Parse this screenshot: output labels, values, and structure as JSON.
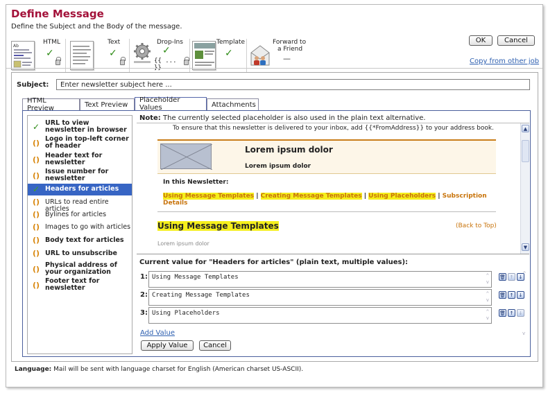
{
  "window": {
    "title": "Define Message",
    "subtitle": "Define the Subject and the Body of the message."
  },
  "toolbar": {
    "html_label": "HTML",
    "text_label": "Text",
    "dropins_label": "Drop-Ins",
    "dropins_code": "{{ ... }}",
    "template_label": "Template",
    "forward_label_1": "Forward to",
    "forward_label_2": "a Friend",
    "forward_status": "—",
    "check": "✓",
    "ok_label": "OK",
    "cancel_label": "Cancel",
    "copy_link": "Copy from other job"
  },
  "subject": {
    "label": "Subject:",
    "value": "Enter newsletter subject here ..."
  },
  "tabs": [
    {
      "label": "HTML Preview"
    },
    {
      "label": "Text Preview"
    },
    {
      "label": "Placeholder Values"
    },
    {
      "label": "Attachments"
    }
  ],
  "placeholders": [
    {
      "label": "URL to view newsletter in browser",
      "status": "done"
    },
    {
      "label": "Logo in top-left corner of header",
      "status": "pending"
    },
    {
      "label": "Header text for newsletter",
      "status": "pending"
    },
    {
      "label": "Issue number for newsletter",
      "status": "pending"
    },
    {
      "label": "Headers for articles",
      "status": "done"
    },
    {
      "label": "URLs to read entire articles",
      "status": "pending"
    },
    {
      "label": "Bylines for articles",
      "status": "pending"
    },
    {
      "label": "Images to go with articles",
      "status": "pending"
    },
    {
      "label": "Body text for articles",
      "status": "pending"
    },
    {
      "label": "URL to unsubscribe",
      "status": "pending"
    },
    {
      "label": "Physical address of your organization",
      "status": "pending"
    },
    {
      "label": "Footer text for newsletter",
      "status": "pending"
    }
  ],
  "note": {
    "label": "Note:",
    "text": "The currently selected placeholder is also used in the plain text alternative."
  },
  "preview": {
    "inbox_text": "To ensure that this newsletter is delivered to your inbox, add {{*FromAddress}} to your address book.",
    "header_title": "Lorem ipsum dolor",
    "header_sub": "Lorem ipsum dolor",
    "in_this": "In this Newsletter:",
    "link1": "Using Message Templates",
    "sep": "|",
    "link2": "Creating Message Templates",
    "link3": "Using Placeholders",
    "link4": "Subscription Details",
    "article_title": "Using Message Templates",
    "back_to_top": "(Back to Top)",
    "body": "Lorem ipsum dolor"
  },
  "current": {
    "label": "Current value for \"Headers for articles\" (plain text, multiple values):",
    "values": [
      {
        "n": "1:",
        "text": "Using Message Templates"
      },
      {
        "n": "2:",
        "text": "Creating Message Templates"
      },
      {
        "n": "3:",
        "text": "Using Placeholders"
      }
    ],
    "add_value": "Add Value",
    "apply_label": "Apply Value",
    "cancel_label": "Cancel"
  },
  "language": {
    "label": "Language:",
    "text": "Mail will be sent with language charset for English (American charset US-ASCII)."
  },
  "colors": {
    "title": "#a3123a",
    "selected": "#3765c4",
    "highlight": "#f5ef1c",
    "check": "#2c8a14",
    "pending": "#d8860c"
  }
}
